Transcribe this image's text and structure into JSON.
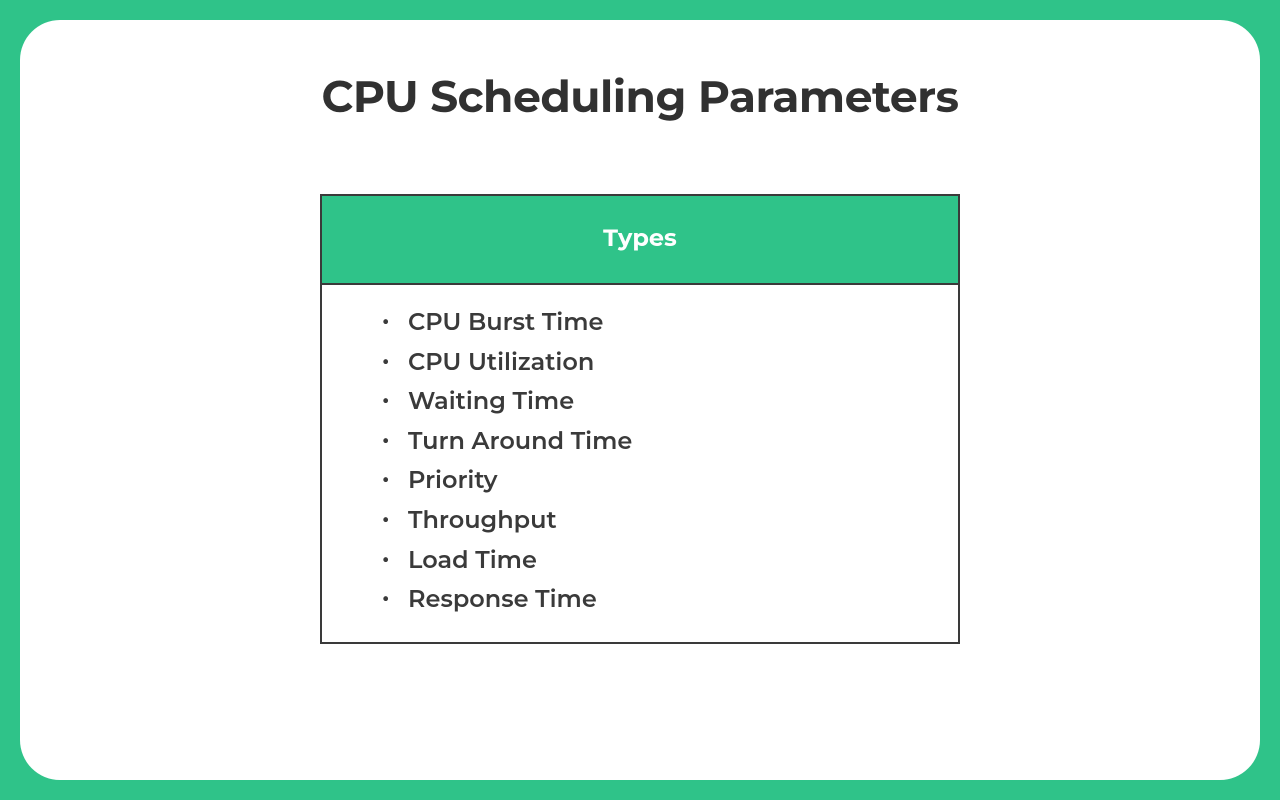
{
  "title": "CPU Scheduling Parameters",
  "table": {
    "header": "Types",
    "items": [
      "CPU Burst Time",
      "CPU Utilization",
      "Waiting Time",
      "Turn Around Time",
      "Priority",
      "Throughput",
      "Load Time",
      "Response Time"
    ]
  },
  "colors": {
    "accent": "#2fc389",
    "text": "#3a3a3a",
    "background": "#ffffff"
  }
}
